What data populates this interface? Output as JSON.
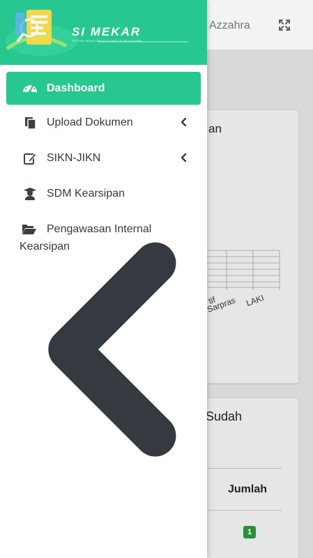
{
  "header": {
    "user_name": "Azzahra"
  },
  "brand": {
    "name": "SI MEKAR",
    "tagline": "SISTEM MONITORING KINERJA KEARSIPAN"
  },
  "sidebar": {
    "items": [
      {
        "label": "Dashboard",
        "icon": "tachometer-icon",
        "active": true
      },
      {
        "label": "Upload Dokumen",
        "icon": "copy-icon",
        "has_submenu": true
      },
      {
        "label": "SIKN-JIKN",
        "icon": "edit-icon",
        "has_submenu": true
      },
      {
        "label": "SDM Kearsipan",
        "icon": "user-graduate-icon"
      },
      {
        "label_line1": "Pengawasan Internal",
        "label_line2": "Kearsipan",
        "icon": "folder-open-icon",
        "has_submenu": true
      }
    ]
  },
  "background": {
    "card1": {
      "title_fragment": "an",
      "tick_labels": [
        "tif",
        "Sarpras",
        "LAKI"
      ]
    },
    "card2": {
      "title_fragment": "Sudah",
      "column_header": "Jumlah",
      "badge_value": "1"
    }
  },
  "colors": {
    "accent": "#28c790",
    "badge": "#2c8e3c"
  }
}
